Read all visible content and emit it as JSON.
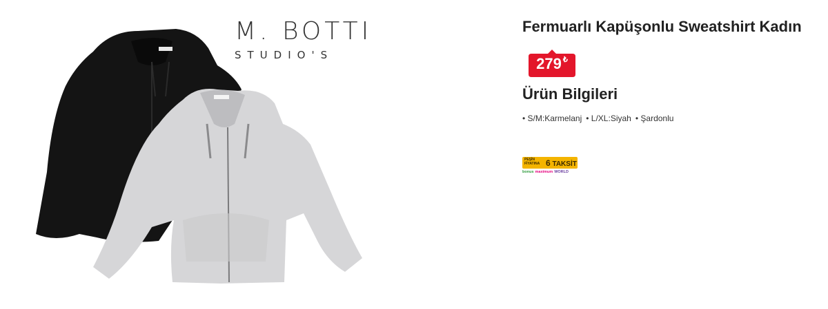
{
  "brand": {
    "name": "M. BOTTI",
    "subtitle": "STUDIO'S"
  },
  "product": {
    "title": "Fermuarlı Kapüşonlu Sweatshirt Kadın",
    "price": {
      "value": "279",
      "currency": "₺"
    }
  },
  "info": {
    "title": "Ürün Bilgileri",
    "features": [
      "S/M:Karmelanj",
      "L/XL:Siyah",
      "Şardonlu"
    ]
  },
  "installment": {
    "label_small_1": "PEŞİN",
    "label_small_2": "FİYATINA",
    "count": "6",
    "label": "TAKSİT",
    "stores": [
      "bonus",
      "maximum",
      "WORLD"
    ]
  },
  "colors": {
    "price_badge": "#e3162b",
    "installment_bg": "#f4b400",
    "hoodie_black": "#141414",
    "hoodie_grey": "#d6d6d8"
  }
}
